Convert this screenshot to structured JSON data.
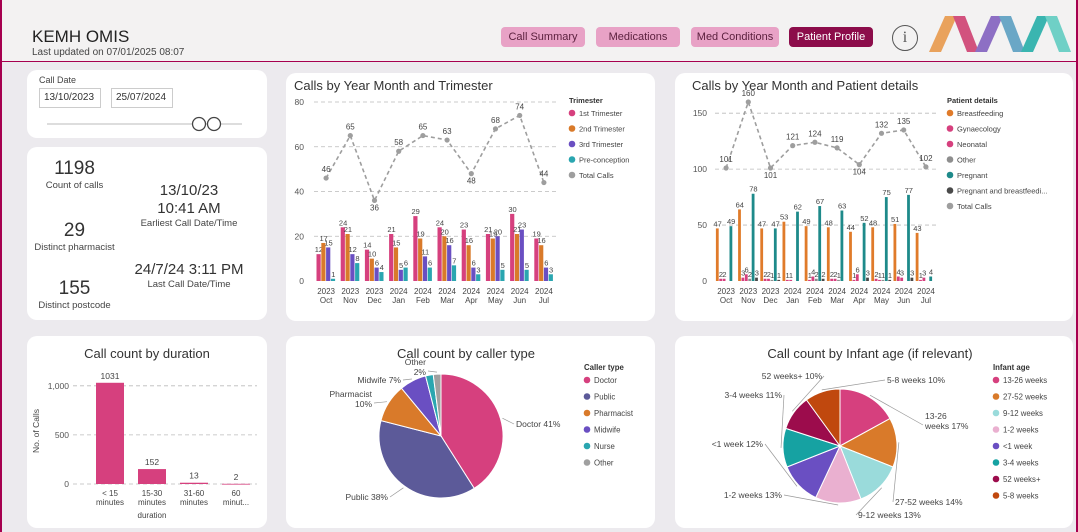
{
  "header": {
    "app_title": "KEMH OMIS",
    "last_updated": "Last updated on 07/01/2025 08:07",
    "nav": [
      "Call Summary",
      "Medications",
      "Med Conditions",
      "Patient Profile"
    ],
    "active_nav": "Patient Profile",
    "info_icon": "info-icon",
    "logo_colors": [
      "#e9a25c",
      "#d2527e",
      "#7b6fc4",
      "#3ab5b0"
    ]
  },
  "filters": {
    "call_date_label": "Call Date",
    "date_from": "13/10/2023",
    "date_to": "25/07/2024",
    "slider_icon": "range-slider-handles"
  },
  "kpis": {
    "count_of_calls": {
      "value": "1198",
      "label": "Count of calls"
    },
    "distinct_pharmacist": {
      "value": "29",
      "label": "Distinct pharmacist"
    },
    "distinct_postcode": {
      "value": "155",
      "label": "Distinct postcode"
    },
    "earliest": {
      "value": "13/10/23 10:41 AM",
      "label": "Earliest Call Date/Time"
    },
    "last": {
      "value": "24/7/24 3:11 PM",
      "label": "Last Call Date/Time"
    }
  },
  "chart_data": [
    {
      "type": "bar",
      "title": "Calls by Year Month and Trimester",
      "legend_title": "Trimester",
      "legend_position": "right",
      "categories": [
        [
          "2023",
          "Oct"
        ],
        [
          "2023",
          "Nov"
        ],
        [
          "2023",
          "Dec"
        ],
        [
          "2024",
          "Jan"
        ],
        [
          "2024",
          "Feb"
        ],
        [
          "2024",
          "Mar"
        ],
        [
          "2024",
          "Apr"
        ],
        [
          "2024",
          "May"
        ],
        [
          "2024",
          "Jun"
        ],
        [
          "2024",
          "Jul"
        ]
      ],
      "ylim": [
        0,
        80
      ],
      "yticks": [
        0,
        20,
        40,
        60,
        80
      ],
      "series": [
        {
          "name": "1st Trimester",
          "color": "#d6407e",
          "values": [
            12,
            24,
            14,
            21,
            29,
            24,
            23,
            21,
            30,
            19
          ]
        },
        {
          "name": "2nd Trimester",
          "color": "#d97a2a",
          "values": [
            17,
            21,
            10,
            15,
            19,
            20,
            16,
            19,
            21,
            16
          ]
        },
        {
          "name": "3rd Trimester",
          "color": "#6a4fc2",
          "values": [
            15,
            12,
            6,
            5,
            11,
            16,
            6,
            20,
            23,
            6
          ]
        },
        {
          "name": "Pre-conception",
          "color": "#2aa6b0",
          "values": [
            1,
            8,
            4,
            6,
            6,
            7,
            3,
            5,
            5,
            3
          ]
        }
      ],
      "line": {
        "name": "Total Calls",
        "color": "#9e9e9e",
        "values": [
          46,
          65,
          36,
          58,
          65,
          63,
          48,
          68,
          74,
          44
        ]
      }
    },
    {
      "type": "bar",
      "title": "Calls by Year Month and Patient details",
      "legend_title": "Patient details",
      "legend_position": "right",
      "categories": [
        [
          "2023",
          "Oct"
        ],
        [
          "2023",
          "Nov"
        ],
        [
          "2023",
          "Dec"
        ],
        [
          "2024",
          "Jan"
        ],
        [
          "2024",
          "Feb"
        ],
        [
          "2024",
          "Mar"
        ],
        [
          "2024",
          "Apr"
        ],
        [
          "2024",
          "May"
        ],
        [
          "2024",
          "Jun"
        ],
        [
          "2024",
          "Jul"
        ]
      ],
      "ylim": [
        0,
        160
      ],
      "yticks": [
        0,
        50,
        100,
        150
      ],
      "series": [
        {
          "name": "Breastfeeding",
          "color": "#e07b2a",
          "values": [
            47,
            64,
            47,
            53,
            49,
            48,
            44,
            48,
            51,
            43
          ]
        },
        {
          "name": "Gynaecology",
          "color": "#d6407e",
          "values": [
            2,
            3,
            2,
            1,
            1,
            2,
            1,
            2,
            4,
            1
          ]
        },
        {
          "name": "Neonatal",
          "color": "#d6407e",
          "values": [
            2,
            6,
            2,
            1,
            4,
            2,
            6,
            1,
            3,
            3
          ]
        },
        {
          "name": "Other",
          "color": "#8e8e8e",
          "values": [
            0,
            2,
            1,
            0,
            2,
            1,
            0,
            1,
            0,
            0
          ]
        },
        {
          "name": "Pregnant",
          "color": "#1e8a8a",
          "values": [
            49,
            78,
            47,
            62,
            67,
            63,
            52,
            75,
            77,
            4
          ]
        },
        {
          "name": "Pregnant and breastfeedi...",
          "color": "#4a4a4a",
          "values": [
            0,
            3,
            1,
            0,
            2,
            0,
            3,
            1,
            3,
            0
          ]
        }
      ],
      "line": {
        "name": "Total Calls",
        "color": "#9e9e9e",
        "values": [
          101,
          160,
          101,
          121,
          124,
          119,
          104,
          132,
          135,
          102
        ]
      }
    },
    {
      "type": "bar",
      "title": "Call count by duration",
      "ylabel": "No. of Calls",
      "xlabel": "duration",
      "categories": [
        "< 15 minutes",
        "15-30 minutes",
        "31-60 minutes",
        "60 minut..."
      ],
      "values": [
        1031,
        152,
        13,
        2
      ],
      "value_labels": [
        "1031",
        "152",
        "13",
        "2"
      ],
      "ylim": [
        0,
        1100
      ],
      "yticks": [
        0,
        500,
        1000
      ],
      "ytick_labels": [
        "0",
        "500",
        "1,000"
      ],
      "color": "#d6407e"
    },
    {
      "type": "pie",
      "title": "Call count by caller type",
      "legend_title": "Caller type",
      "legend_position": "right",
      "slices": [
        {
          "name": "Doctor",
          "value": 41,
          "label": "Doctor 41%",
          "color": "#d6407e"
        },
        {
          "name": "Public",
          "value": 38,
          "label": "Public 38%",
          "color": "#5c5a99"
        },
        {
          "name": "Pharmacist",
          "value": 10,
          "label": "Pharmacist 10%",
          "color": "#d97a2a"
        },
        {
          "name": "Midwife",
          "value": 7,
          "label": "Midwife 7%",
          "color": "#6a4fc2"
        },
        {
          "name": "Nurse",
          "value": 2,
          "label": "",
          "color": "#2aa6b0"
        },
        {
          "name": "Other",
          "value": 2,
          "label": "Other 2%",
          "color": "#a0a0a0"
        }
      ]
    },
    {
      "type": "pie",
      "title": "Call count by Infant age (if relevant)",
      "legend_title": "Infant age",
      "legend_position": "right",
      "slices": [
        {
          "name": "13-26 weeks",
          "value": 17,
          "label": "13-26 weeks 17%",
          "color": "#d6407e"
        },
        {
          "name": "27-52 weeks",
          "value": 14,
          "label": "27-52 weeks 14%",
          "color": "#d97a2a"
        },
        {
          "name": "9-12 weeks",
          "value": 13,
          "label": "9-12 weeks 13%",
          "color": "#9adbdb"
        },
        {
          "name": "1-2 weeks",
          "value": 13,
          "label": "1-2 weeks 13%",
          "color": "#eab0d0"
        },
        {
          "name": "<1 week",
          "value": 12,
          "label": "<1 week 12%",
          "color": "#6a4fc2"
        },
        {
          "name": "3-4 weeks",
          "value": 11,
          "label": "3-4 weeks 11%",
          "color": "#16a2a2"
        },
        {
          "name": "52 weeks+",
          "value": 10,
          "label": "52 weeks+ 10%",
          "color": "#9c0c4c"
        },
        {
          "name": "5-8 weeks",
          "value": 10,
          "label": "5-8 weeks 10%",
          "color": "#c0480e"
        }
      ]
    }
  ]
}
